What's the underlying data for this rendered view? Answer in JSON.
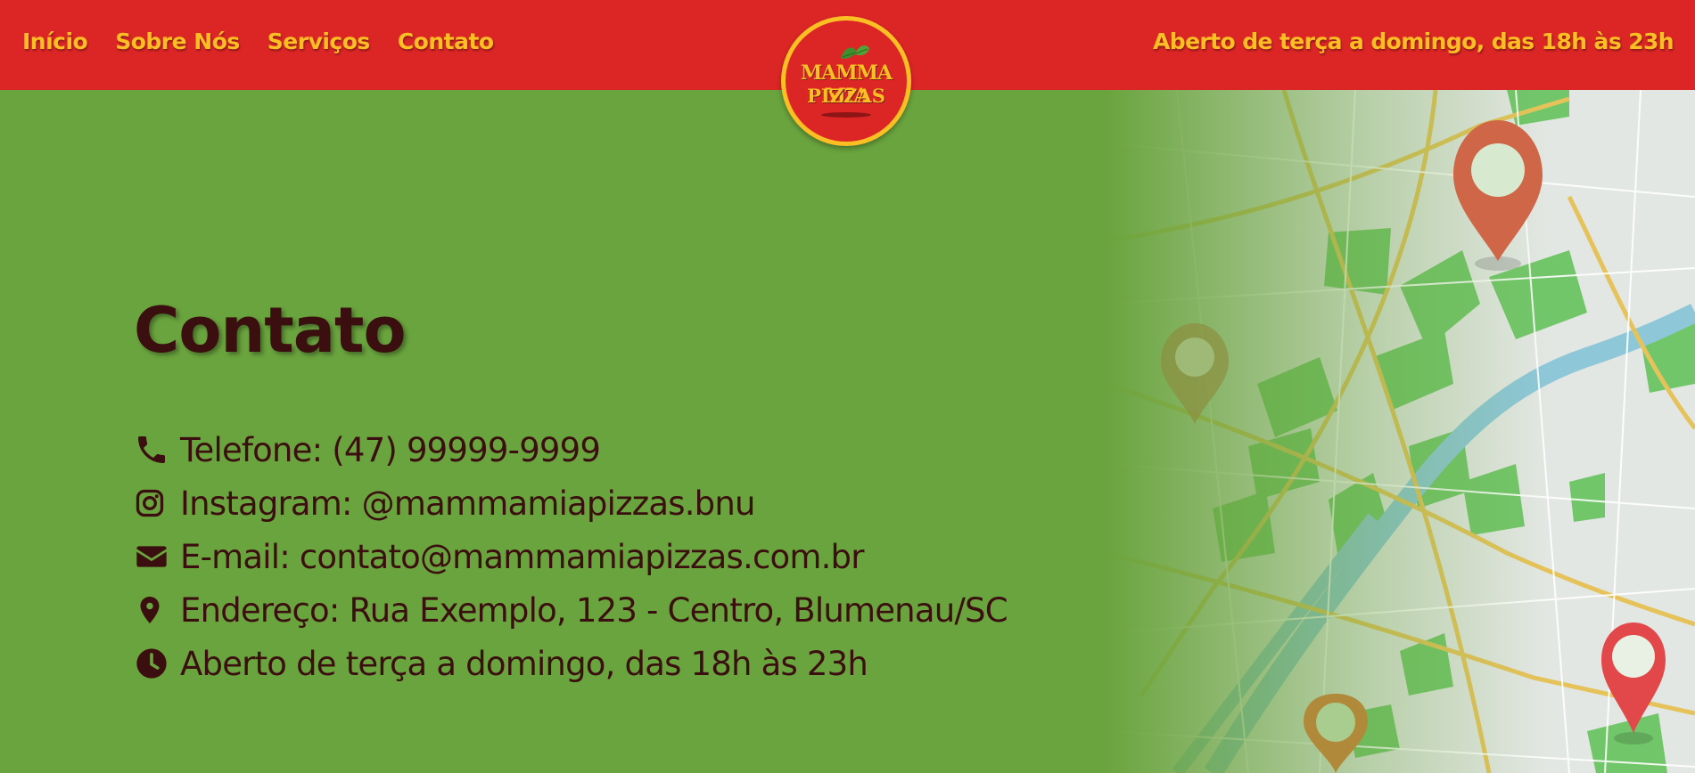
{
  "nav": {
    "links": [
      "Início",
      "Sobre Nós",
      "Serviços",
      "Contato"
    ],
    "hours": "Aberto de terça a domingo, das 18h às 23h"
  },
  "logo": {
    "line1": "MAMMA MIA",
    "line2": "PIZZAS"
  },
  "contact": {
    "title": "Contato",
    "items": [
      {
        "icon": "phone-icon",
        "text": "Telefone: (47) 99999-9999"
      },
      {
        "icon": "instagram-icon",
        "text": "Instagram: @mammamiapizzas.bnu"
      },
      {
        "icon": "envelope-icon",
        "text": "E-mail: contato@mammamiapizzas.com.br"
      },
      {
        "icon": "location-pin-icon",
        "text": "Endereço: Rua Exemplo, 123 - Centro, Blumenau/SC"
      },
      {
        "icon": "clock-icon",
        "text": "Aberto de terça a domingo, das 18h às 23h"
      }
    ]
  },
  "colors": {
    "nav_bg": "#dc2626",
    "accent": "#fbbf24",
    "page_bg": "#6aa43e",
    "text": "#3b0f0f"
  }
}
